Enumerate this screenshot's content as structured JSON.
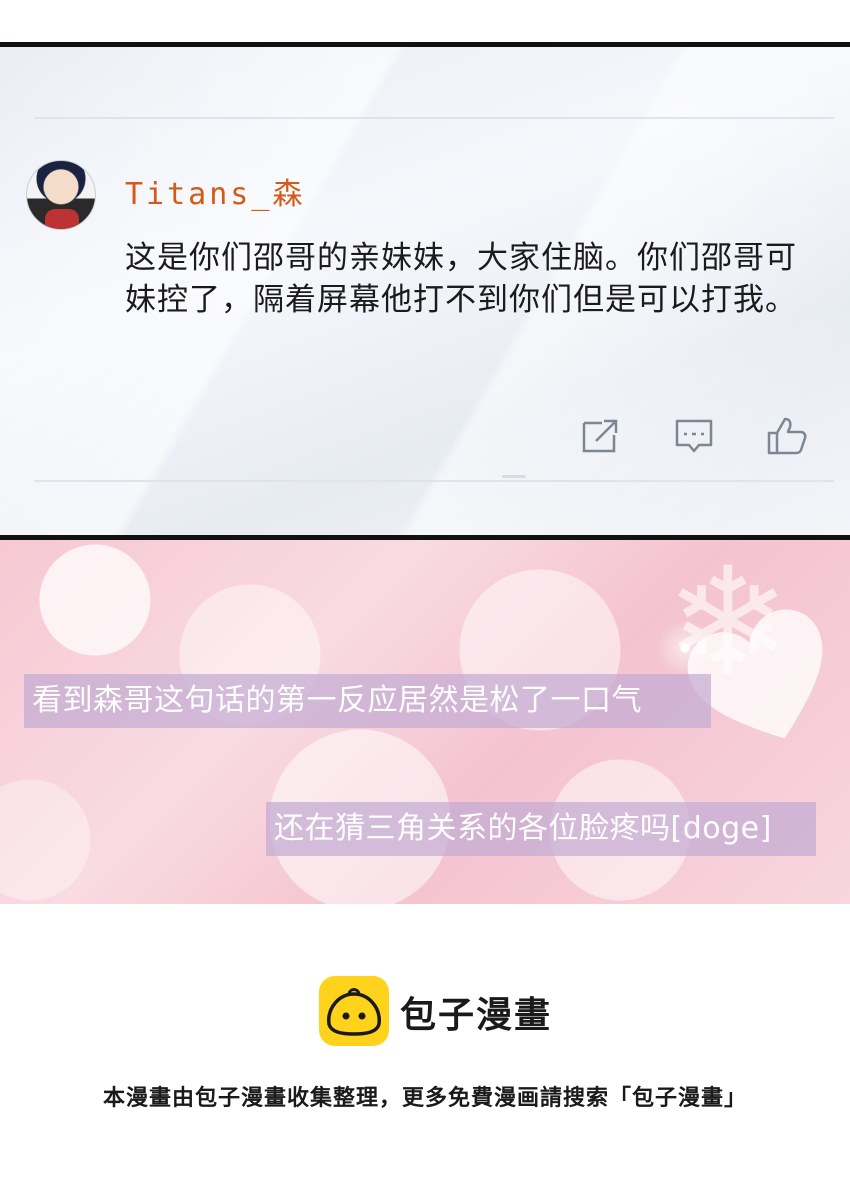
{
  "comment": {
    "username": "Titans_森",
    "text": "这是你们邵哥的亲妹妹，大家住脑。你们邵哥可妹控了，隔着屏幕他打不到你们但是可以打我。",
    "username_color": "#d35a19"
  },
  "actions": {
    "share_icon": "share-icon",
    "reply_icon": "comment-icon",
    "like_icon": "thumbs-up-icon"
  },
  "captions": [
    "看到森哥这句话的第一反应居然是松了一口气",
    "还在猜三角关系的各位脸疼吗[doge]"
  ],
  "footer": {
    "brand_name": "包子漫畫",
    "note": "本漫畫由包子漫畫收集整理，更多免費漫画請搜索「包子漫畫」"
  },
  "colors": {
    "logo_yellow": "#ffd31c",
    "caption_bg": "#c4aad2",
    "pink_bg": "#f6c8d2"
  }
}
